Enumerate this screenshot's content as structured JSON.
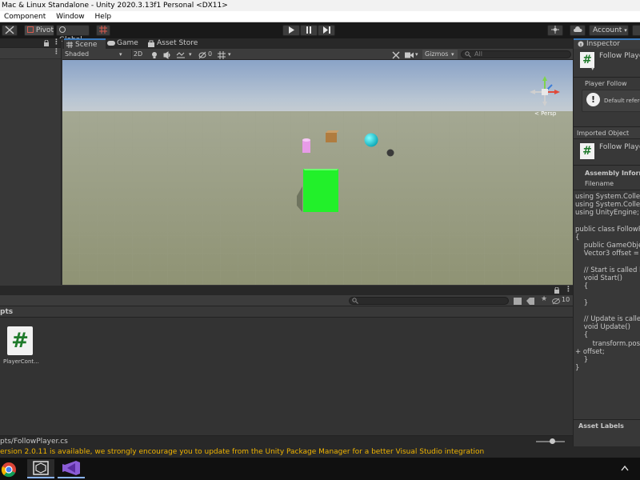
{
  "window": {
    "title": "Mac & Linux Standalone - Unity 2020.3.13f1 Personal <DX11>"
  },
  "menu": [
    "Component",
    "Window",
    "Help"
  ],
  "toolbar": {
    "pivot_label": "Pivot",
    "global_label": "Global",
    "account_label": "Account"
  },
  "scene_view": {
    "tabs": [
      "Scene",
      "Game",
      "Asset Store"
    ],
    "shading_mode": "Shaded",
    "mode_2d": "2D",
    "hidden_count": "0",
    "gizmos_label": "Gizmos",
    "search_placeholder": "All",
    "persp_label": "< Persp"
  },
  "project": {
    "breadcrumb": "pts",
    "asset_count": "10",
    "asset_name": "PlayerCont...",
    "asset_icon": "#",
    "selected_path": "pts/FollowPlayer.cs"
  },
  "inspector": {
    "tab_label": "Inspector",
    "script_title": "Follow Player",
    "script_icon": "#",
    "component_label": "Player Follow",
    "default_ref_text": "Default refere",
    "imported_object_label": "Imported Object",
    "imported_title": "Follow Player",
    "assembly_label": "Assembly Informa",
    "filename_label": "Filename",
    "code": "using System.Collecti\nusing System.Collecti\nusing UnityEngine;\n\npublic class FollowPla\n{\n    public GameObject\n    Vector3 offset = ne\n\n    // Start is called bef\n    void Start()\n    {\n\n    }\n\n    // Update is called c\n    void Update()\n    {\n        transform.position\n+ offset;\n    }\n}",
    "asset_labels": "Asset Labels"
  },
  "console": {
    "message": "ersion 2.0.11 is available, we strongly encourage you to update from the Unity Package Manager for a better Visual Studio integration"
  },
  "taskbar": {
    "apps": [
      "chrome-icon",
      "unity-icon",
      "visual-studio-icon"
    ]
  },
  "colors": {
    "accent": "#3a79bb",
    "cube": "#22f02a",
    "console_warning": "#f0b400"
  }
}
